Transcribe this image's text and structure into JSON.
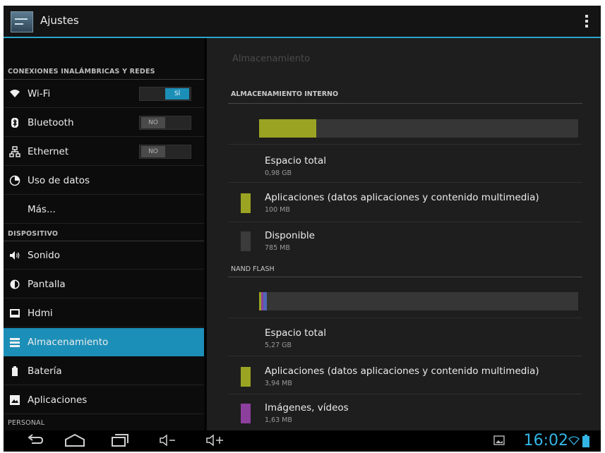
{
  "app": {
    "title": "Ajustes"
  },
  "left_pane": {
    "sections": [
      {
        "header": "CONEXIONES INALÁMBRICAS Y REDES"
      },
      {
        "header": "DISPOSITIVO"
      },
      {
        "header": "PERSONAL"
      }
    ],
    "items": [
      {
        "label": "Wi-Fi",
        "icon": "wifi-icon",
        "toggle": "SÍ",
        "toggle_state": "on"
      },
      {
        "label": "Bluetooth",
        "icon": "bluetooth-icon",
        "toggle": "NO",
        "toggle_state": "off"
      },
      {
        "label": "Ethernet",
        "icon": "ethernet-icon",
        "toggle": "NO",
        "toggle_state": "off"
      },
      {
        "label": "Uso de datos",
        "icon": "data-usage-icon"
      },
      {
        "label": "Más..."
      },
      {
        "label": "Sonido",
        "icon": "speaker-icon"
      },
      {
        "label": "Pantalla",
        "icon": "brightness-icon"
      },
      {
        "label": "Hdmi",
        "icon": "hdmi-icon"
      },
      {
        "label": "Almacenamiento",
        "icon": "storage-icon",
        "selected": true
      },
      {
        "label": "Batería",
        "icon": "battery-icon"
      },
      {
        "label": "Aplicaciones",
        "icon": "apps-icon"
      }
    ]
  },
  "right_pane": {
    "title": "Almacenamiento",
    "internal": {
      "header": "ALMACENAMIENTO INTERNO",
      "used_fraction": 0.18,
      "total": {
        "label": "Espacio total",
        "value": "0,98 GB"
      },
      "apps": {
        "label": "Aplicaciones (datos aplicaciones y contenido multimedia)",
        "value": "100 MB"
      },
      "available": {
        "label": "Disponible",
        "value": "785 MB"
      }
    },
    "nand": {
      "header": "NAND FLASH",
      "segments": [
        {
          "name": "apps",
          "fraction": 0.007
        },
        {
          "name": "media",
          "fraction": 0.007
        },
        {
          "name": "other",
          "fraction": 0.012
        }
      ],
      "total": {
        "label": "Espacio total",
        "value": "5,27 GB"
      },
      "apps": {
        "label": "Aplicaciones (datos aplicaciones y contenido multimedia)",
        "value": "3,94 MB"
      },
      "media": {
        "label": "Imágenes, vídeos",
        "value": "1,63 MB"
      }
    }
  },
  "status": {
    "time": "16:02"
  },
  "colors": {
    "accent": "#33b5e5",
    "selected": "#1c8fb8",
    "apps_segment": "#9aa322",
    "media_segment": "#8c3f9c",
    "other_segment": "#4f66b8",
    "available_segment": "#3b3b3b"
  }
}
